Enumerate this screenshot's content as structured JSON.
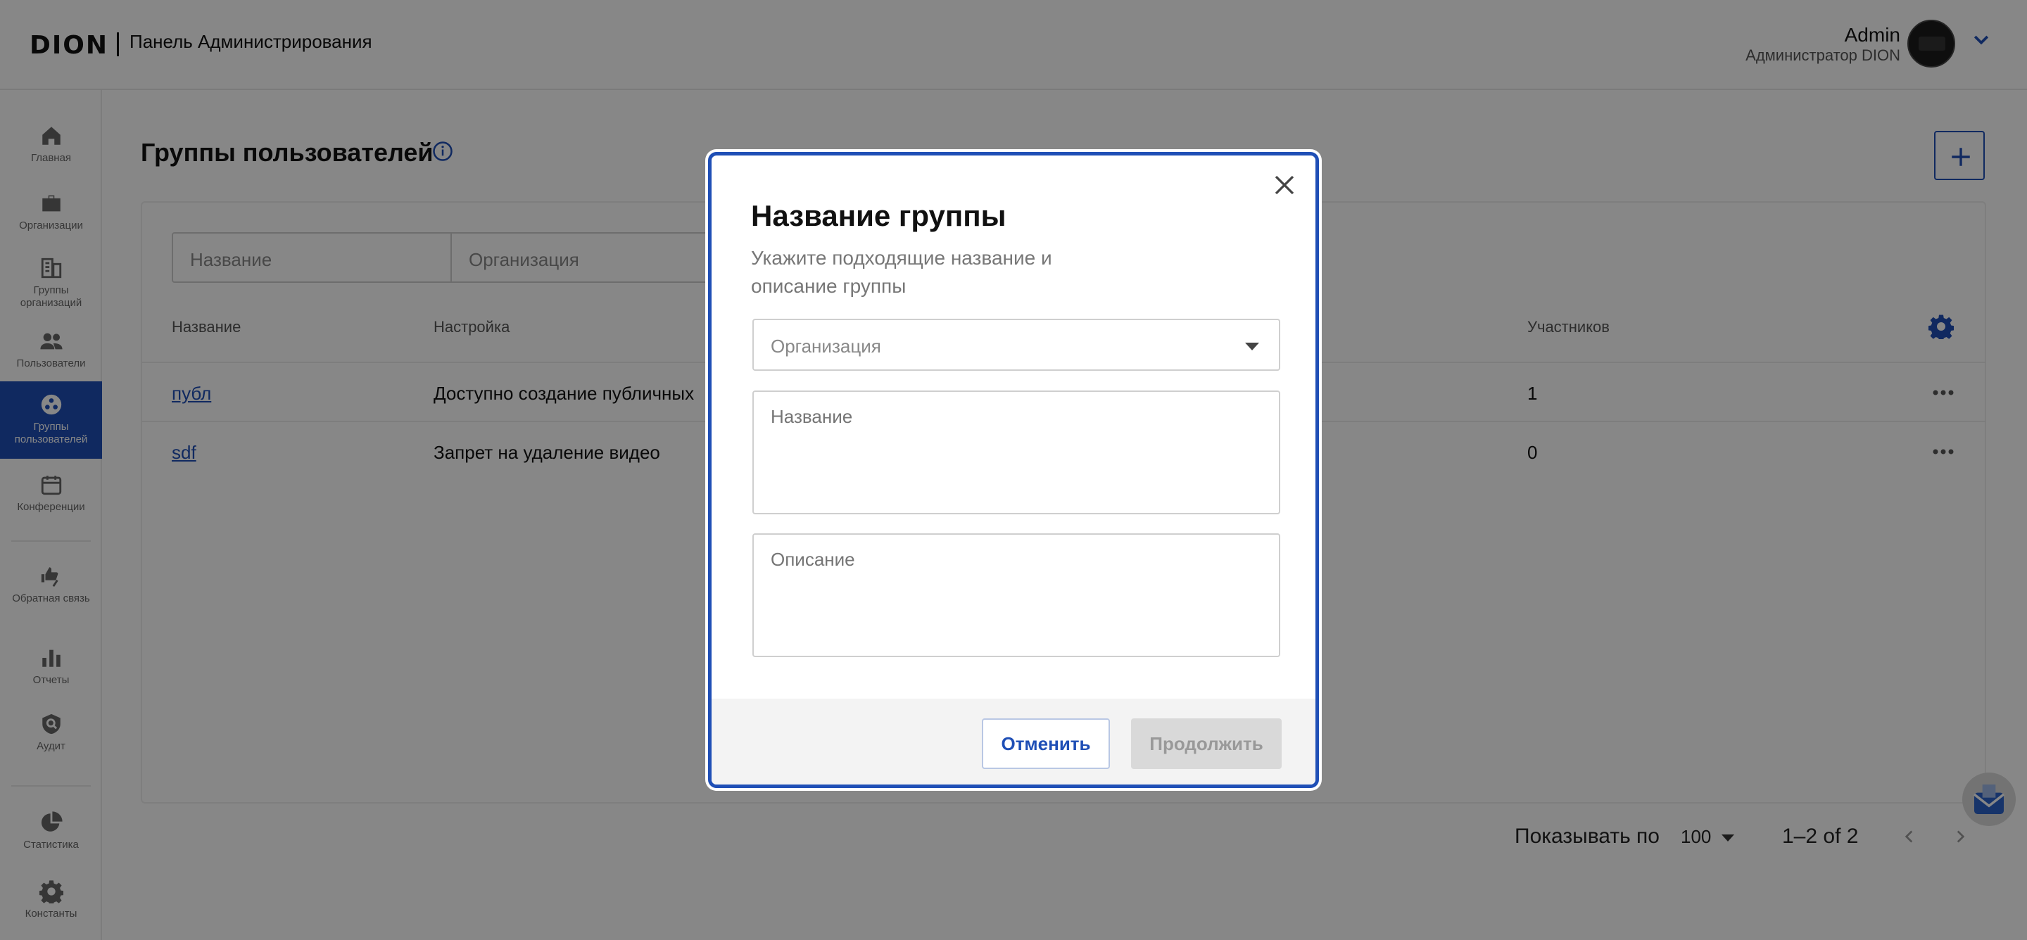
{
  "header": {
    "logo": "DION",
    "title": "Панель Администрирования",
    "user_name": "Admin",
    "user_role": "Администратор DION"
  },
  "sidebar": {
    "items": [
      {
        "label": "Главная",
        "icon": "home-icon"
      },
      {
        "label": "Организации",
        "icon": "briefcase-icon"
      },
      {
        "label": "Группы организаций",
        "icon": "building-icon"
      },
      {
        "label": "Пользователи",
        "icon": "people-icon"
      },
      {
        "label": "Группы пользователей",
        "icon": "user-groups-icon",
        "active": true
      },
      {
        "label": "Конференции",
        "icon": "calendar-icon"
      },
      {
        "label": "Обратная связь",
        "icon": "thumbs-icon"
      },
      {
        "label": "Отчеты",
        "icon": "bar-chart-icon"
      },
      {
        "label": "Аудит",
        "icon": "shield-search-icon"
      },
      {
        "label": "Статистика",
        "icon": "pie-chart-icon"
      },
      {
        "label": "Константы",
        "icon": "gear-icon"
      }
    ]
  },
  "main": {
    "title": "Группы пользователей",
    "filters": {
      "name_placeholder": "Название",
      "org_placeholder": "Организация"
    },
    "table": {
      "columns": [
        "Название",
        "Настройка",
        "Участников"
      ],
      "rows": [
        {
          "name": "публ",
          "setting": "Доступно создание публичных",
          "members": "1"
        },
        {
          "name": "sdf",
          "setting": "Запрет на удаление видео",
          "members": "0"
        }
      ]
    },
    "pager": {
      "label": "Показывать по",
      "size": "100",
      "range": "1–2 of 2"
    }
  },
  "modal": {
    "title": "Название группы",
    "subtitle": "Укажите подходящие название и описание группы",
    "org_placeholder": "Организация",
    "name_placeholder": "Название",
    "desc_placeholder": "Описание",
    "cancel_label": "Отменить",
    "continue_label": "Продолжить"
  },
  "colors": {
    "accent": "#1f4fb6",
    "overlay": "rgba(0,0,0,0.47)"
  }
}
